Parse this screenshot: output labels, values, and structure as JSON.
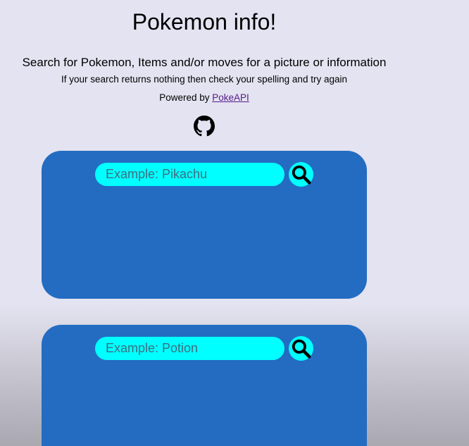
{
  "header": {
    "title": "Pokemon info!",
    "subtitle": "Search for Pokemon, Items and/or moves for a picture or information",
    "hint": "If your search returns nothing then check your spelling and try again",
    "powered_prefix": "Powered by ",
    "powered_link": "PokeAPI"
  },
  "icons": {
    "github": "github-icon",
    "search": "search-icon"
  },
  "cards": [
    {
      "placeholder": "Example: Pikachu"
    },
    {
      "placeholder": "Example: Potion"
    }
  ],
  "colors": {
    "background": "#e4e3f1",
    "card": "#236cc2",
    "input": "#00ffff",
    "link": "#551a8b"
  }
}
